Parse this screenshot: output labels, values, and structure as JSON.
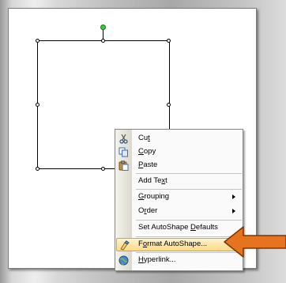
{
  "context_menu": {
    "items": [
      {
        "name": "cut",
        "label": "Cut",
        "accelerator": "t",
        "icon": "scissors-icon"
      },
      {
        "name": "copy",
        "label": "Copy",
        "accelerator": "C",
        "icon": "copy-icon"
      },
      {
        "name": "paste",
        "label": "Paste",
        "accelerator": "P",
        "icon": "clipboard-icon"
      },
      {
        "name": "add-text",
        "label": "Add Text",
        "accelerator": "x"
      },
      {
        "name": "grouping",
        "label": "Grouping",
        "accelerator": "G",
        "submenu": true
      },
      {
        "name": "order",
        "label": "Order",
        "accelerator": "r",
        "submenu": true
      },
      {
        "name": "set-autoshape-defaults",
        "label": "Set AutoShape Defaults",
        "accelerator": "D"
      },
      {
        "name": "format-autoshape",
        "label": "Format AutoShape...",
        "accelerator": "o",
        "highlighted": true,
        "icon": "format-icon"
      },
      {
        "name": "hyperlink",
        "label": "Hyperlink...",
        "accelerator": "H",
        "icon": "hyperlink-icon"
      }
    ]
  },
  "colors": {
    "highlight_border": "#e3a21a",
    "highlight_fill": "#fdd985",
    "pointer_arrow": "#e8731e",
    "rotation_handle": "#33cc33"
  }
}
